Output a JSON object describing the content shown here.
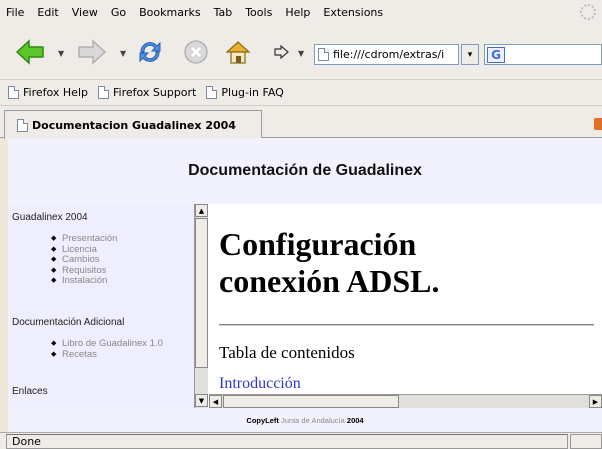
{
  "menu": [
    "File",
    "Edit",
    "View",
    "Go",
    "Bookmarks",
    "Tab",
    "Tools",
    "Help",
    "Extensions"
  ],
  "toolbar": {
    "url": "file:///cdrom/extras/i",
    "dropdown_arrow": "▾"
  },
  "bookmarks": [
    "Firefox Help",
    "Firefox Support",
    "Plug-in FAQ"
  ],
  "tab": {
    "title": "Documentacion Guadalinex 2004"
  },
  "page": {
    "header_title": "Documentación de Guadalinex",
    "sidebar": {
      "section1_title": "Guadalinex 2004",
      "section1_items": [
        "Presentación",
        "Licencia",
        "Cambios",
        "Requisitos",
        "Instalación"
      ],
      "section2_title": "Documentación Adicional",
      "section2_items": [
        "Libro de Guadalinex 1.0",
        "Recetas"
      ],
      "section3_title": "Enlaces"
    },
    "frame": {
      "heading_line1": "Configuración",
      "heading_line2": "conexión ADSL.",
      "toc_title": "Tabla de contenidos",
      "toc_link": "Introducción"
    },
    "footer": {
      "copyleft": "CopyLeft",
      "org": "Junta de Andalucía",
      "year": "2004"
    }
  },
  "status": {
    "text": "Done"
  },
  "colors": {
    "link": "#3333cc",
    "header_bg": "#f2f2ff",
    "sidebar_bg": "#eeeeff",
    "chrome_bg": "#efebe7"
  }
}
